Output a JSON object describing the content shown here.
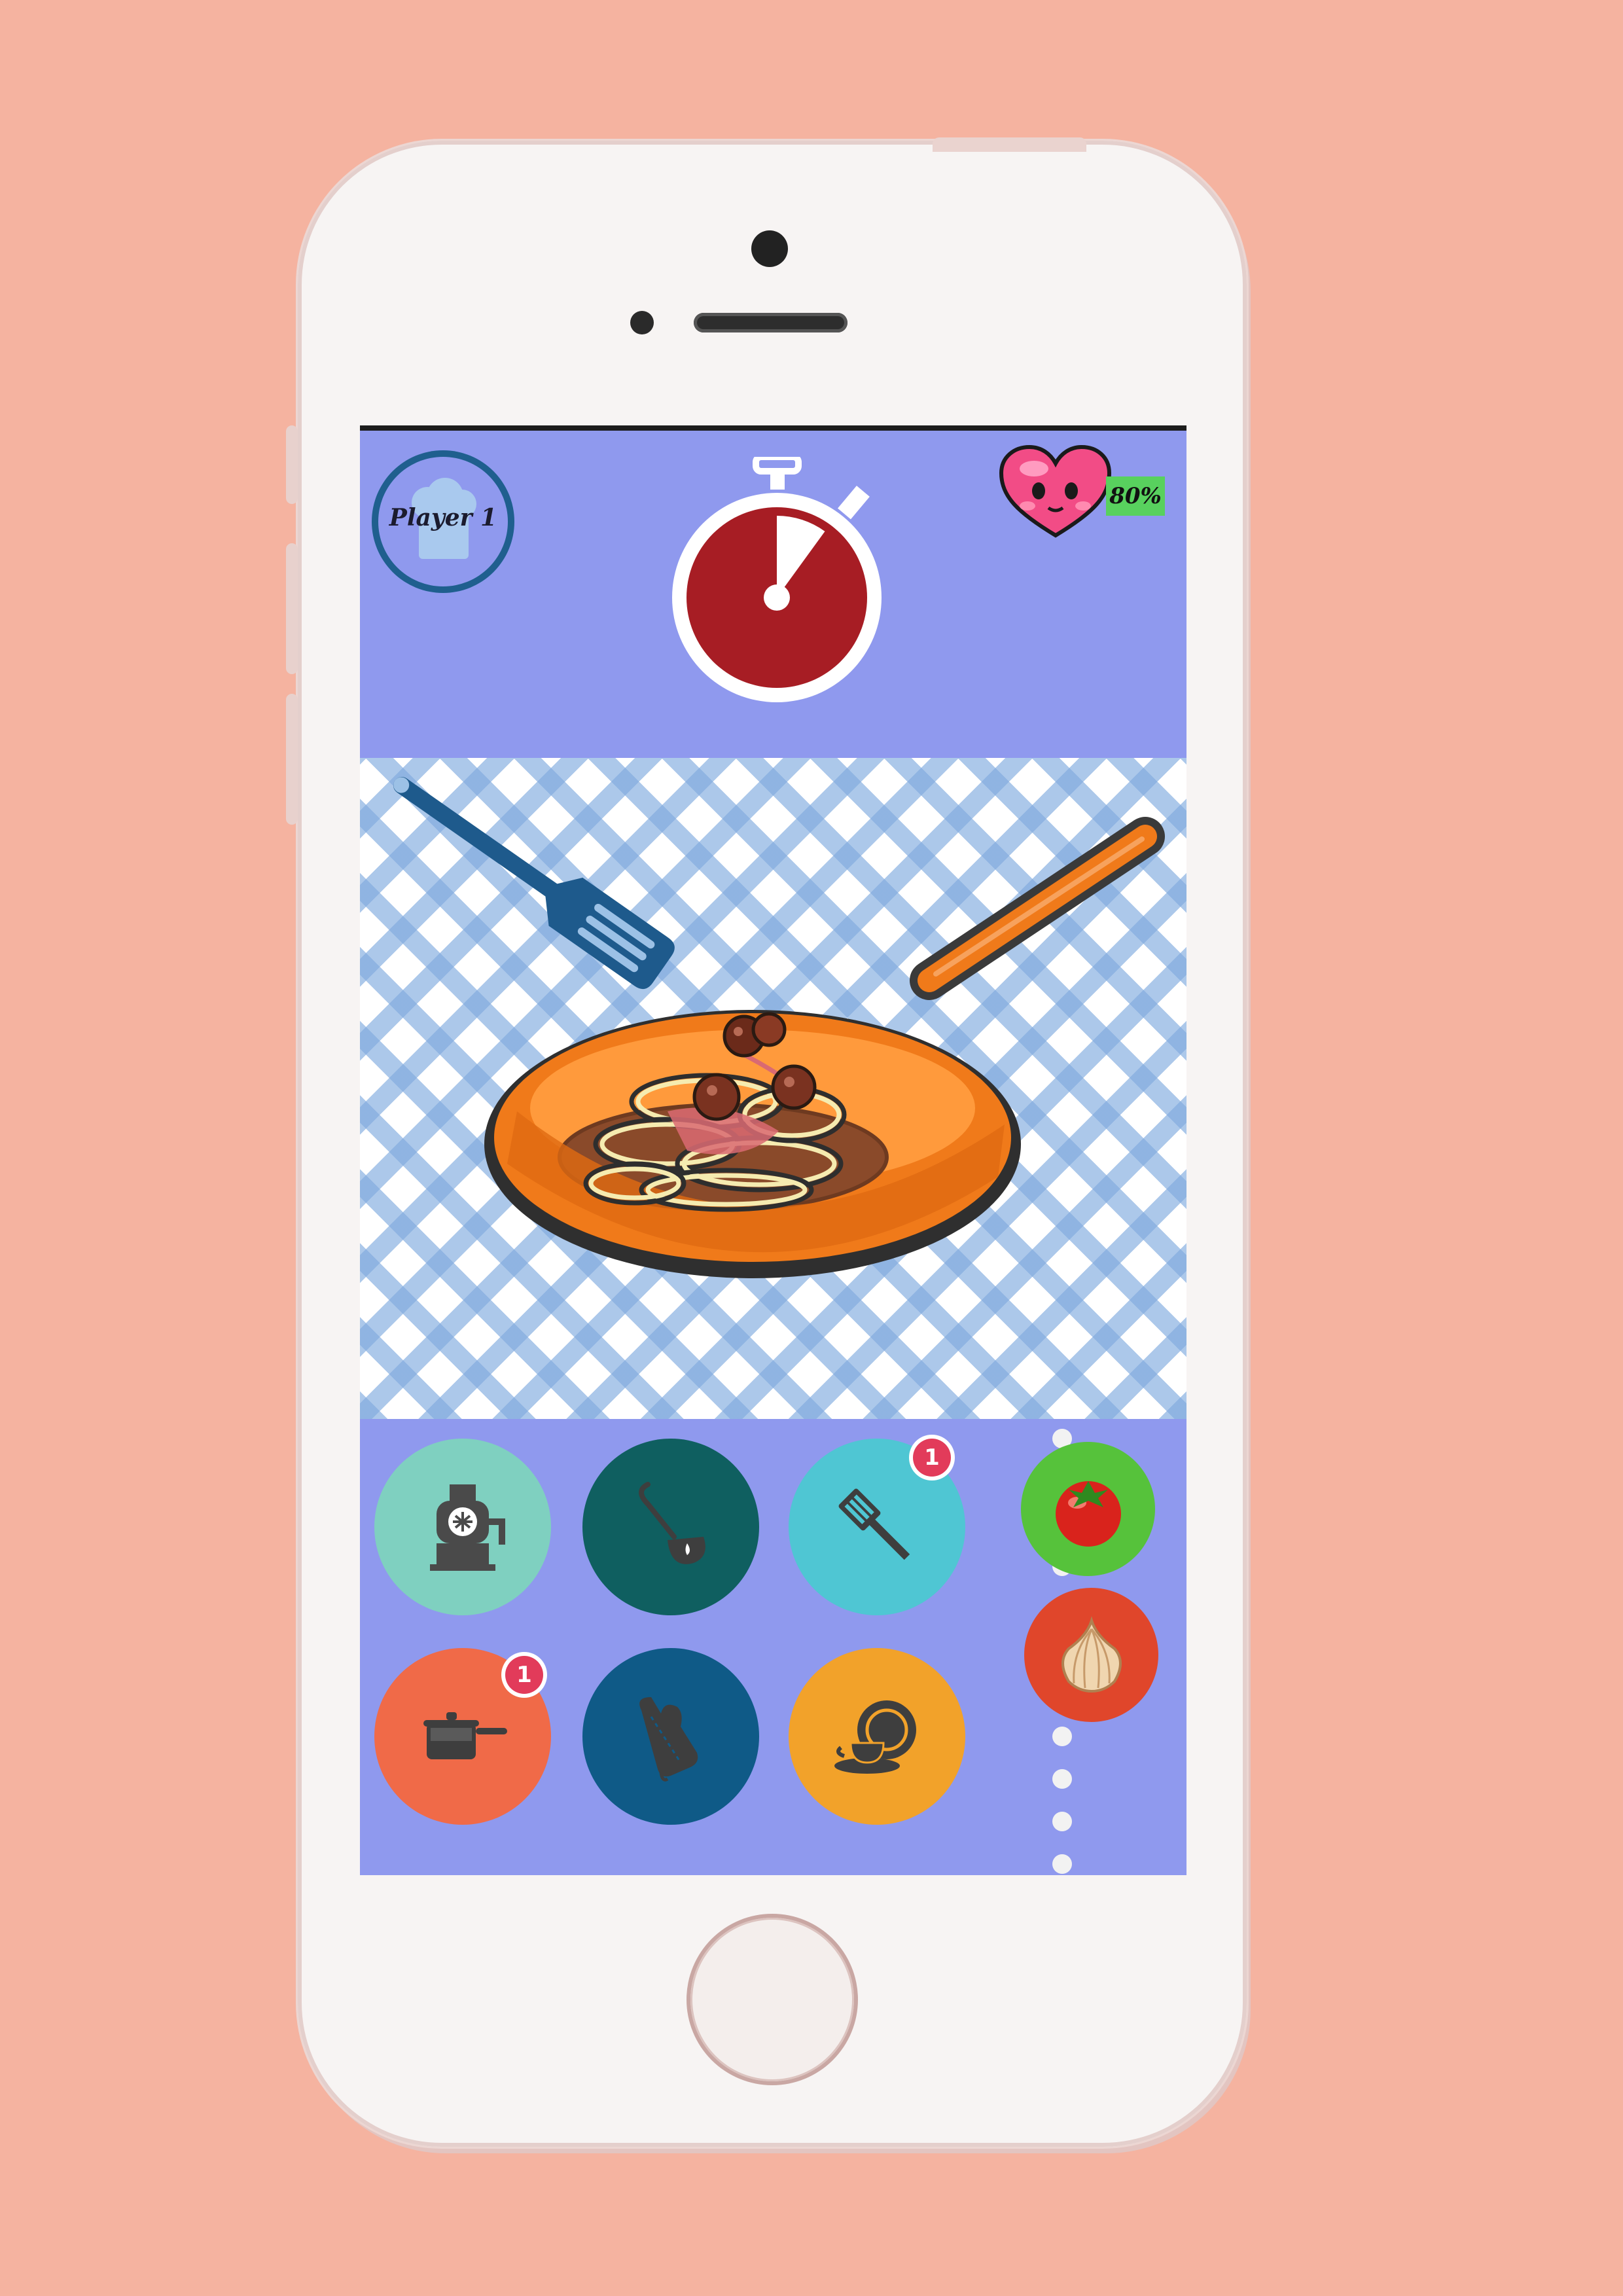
{
  "player": {
    "name": "Player 1"
  },
  "health": {
    "label": "80%",
    "value_percent": 80
  },
  "timer": {
    "icon": "stopwatch-icon",
    "remaining_fraction": 0.9
  },
  "scene": {
    "dish": "spaghetti and meatballs in frying pan"
  },
  "tools": [
    {
      "name": "meat-grinder",
      "icon": "meat-grinder-icon",
      "color": "#7fd0c0",
      "badge": ""
    },
    {
      "name": "ladle",
      "icon": "ladle-icon",
      "color": "#0f5f60",
      "badge": ""
    },
    {
      "name": "spatula",
      "icon": "spatula-icon",
      "color": "#4fc6d3",
      "badge": "1"
    },
    {
      "name": "saucepan",
      "icon": "saucepan-icon",
      "color": "#f06a48",
      "badge": "1"
    },
    {
      "name": "oven-mitt",
      "icon": "oven-mitt-icon",
      "color": "#0f5a87",
      "badge": ""
    },
    {
      "name": "dishes",
      "icon": "dishes-icon",
      "color": "#f2a22a",
      "badge": ""
    }
  ],
  "ingredients": [
    {
      "name": "tomato",
      "icon": "tomato-icon",
      "color": "#56c23b"
    },
    {
      "name": "onion",
      "icon": "onion-icon",
      "color": "#e0462b"
    }
  ]
}
